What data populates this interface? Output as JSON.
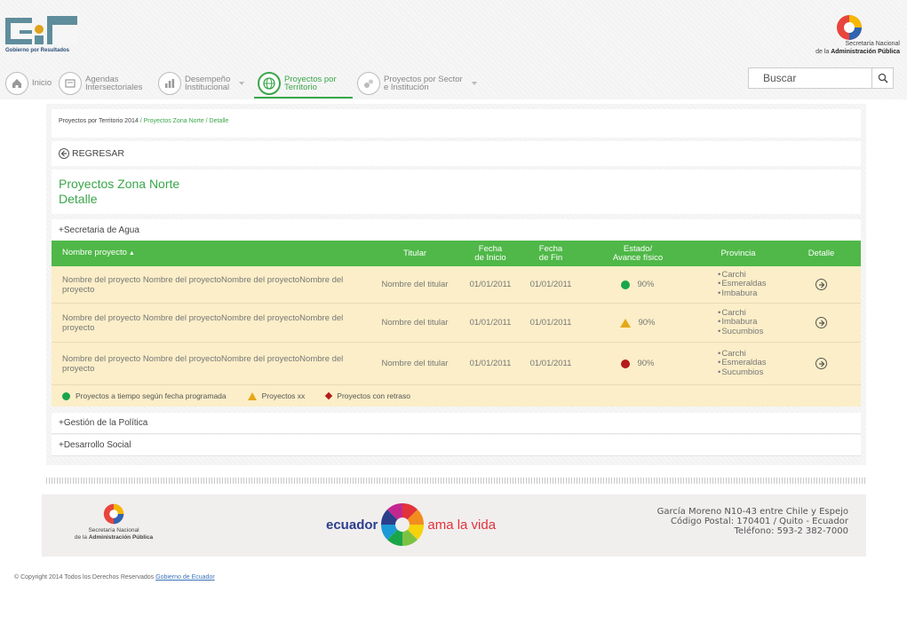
{
  "header": {
    "logo_text": "Gobierno por Resultados",
    "sna_line1": "Secretaría Nacional",
    "sna_line2_prefix": "de la ",
    "sna_line2_bold": "Administración Pública"
  },
  "nav": {
    "items": [
      {
        "label": "Inicio",
        "icon": "home-icon"
      },
      {
        "label": "Agendas\nIntersectoriales",
        "icon": "agenda-icon"
      },
      {
        "label": "Desempeño\nInstitucional",
        "icon": "performance-icon"
      },
      {
        "label": "Proyectos por\nTerritorio",
        "icon": "globe-icon"
      },
      {
        "label": "Proyectos por Sector\ne Institución",
        "icon": "sector-icon"
      }
    ],
    "search_placeholder": "Buscar"
  },
  "breadcrumb": {
    "root": "Proyectos por Territorio 2014",
    "sep": " / ",
    "link1": "Proyectos Zona Norte",
    "link2": "Detalle"
  },
  "back_label": "REGRESAR",
  "page_title": "Proyectos Zona Norte",
  "page_subtitle": "Detalle",
  "sections": {
    "agua": "+Secretaria de Agua",
    "gestion": "+Gestión de la Política",
    "desarrollo": "+Desarrollo Social"
  },
  "table": {
    "headers": {
      "name": "Nombre proyecto",
      "titular": "Titular",
      "fecha_inicio": "Fecha\nde Inicio",
      "fecha_fin": "Fecha\nde Fin",
      "estado": "Estado/\nAvance físico",
      "provincia": "Provincia",
      "detalle": "Detalle"
    },
    "rows": [
      {
        "name": "Nombre del proyecto Nombre del proyectoNombre del proyectoNombre del proyecto",
        "titular": "Nombre del titular",
        "inicio": "01/01/2011",
        "fin": "01/01/2011",
        "status": "green",
        "avance": "90%",
        "provincias": [
          "Carchi",
          "Esmeraldas",
          "Imbabura"
        ]
      },
      {
        "name": "Nombre del proyecto Nombre del proyectoNombre del proyectoNombre del proyecto",
        "titular": "Nombre del titular",
        "inicio": "01/01/2011",
        "fin": "01/01/2011",
        "status": "yellow",
        "avance": "90%",
        "provincias": [
          "Carchi",
          "Imbabura",
          "Sucumbios"
        ]
      },
      {
        "name": "Nombre del proyecto Nombre del proyectoNombre del proyectoNombre del proyecto",
        "titular": "Nombre del titular",
        "inicio": "01/01/2011",
        "fin": "01/01/2011",
        "status": "red",
        "avance": "90%",
        "provincias": [
          "Carchi",
          "Esmeraldas",
          "Sucumbios"
        ]
      }
    ]
  },
  "legend": {
    "on_time": "Proyectos a tiempo según fecha programada",
    "xx": "Proyectos xx",
    "delayed": "Proyectos con retraso"
  },
  "footer": {
    "sna_line1": "Secretaría Nacional",
    "sna_line2_prefix": "de la ",
    "sna_line2_bold": "Administración Pública",
    "ecuador_word": "ecuador",
    "ecuador_tag": "ama la vida",
    "address_line1": "García Moreno N10-43 entre Chile y Espejo",
    "address_line2": "Código Postal: 170401 / Quito - Ecuador",
    "address_line3": "Teléfono: 593-2 382-7000"
  },
  "copyright": {
    "text": "© Copyright 2014 Todos los Derechos Reservados ",
    "link": "Gobierno de Ecuador"
  },
  "colors": {
    "accent_green": "#3aa64a",
    "table_header": "#4fb848",
    "row_bg": "#fbeec8",
    "status_green": "#1aa54a",
    "status_yellow": "#e6a817",
    "status_red": "#b51b1b"
  }
}
